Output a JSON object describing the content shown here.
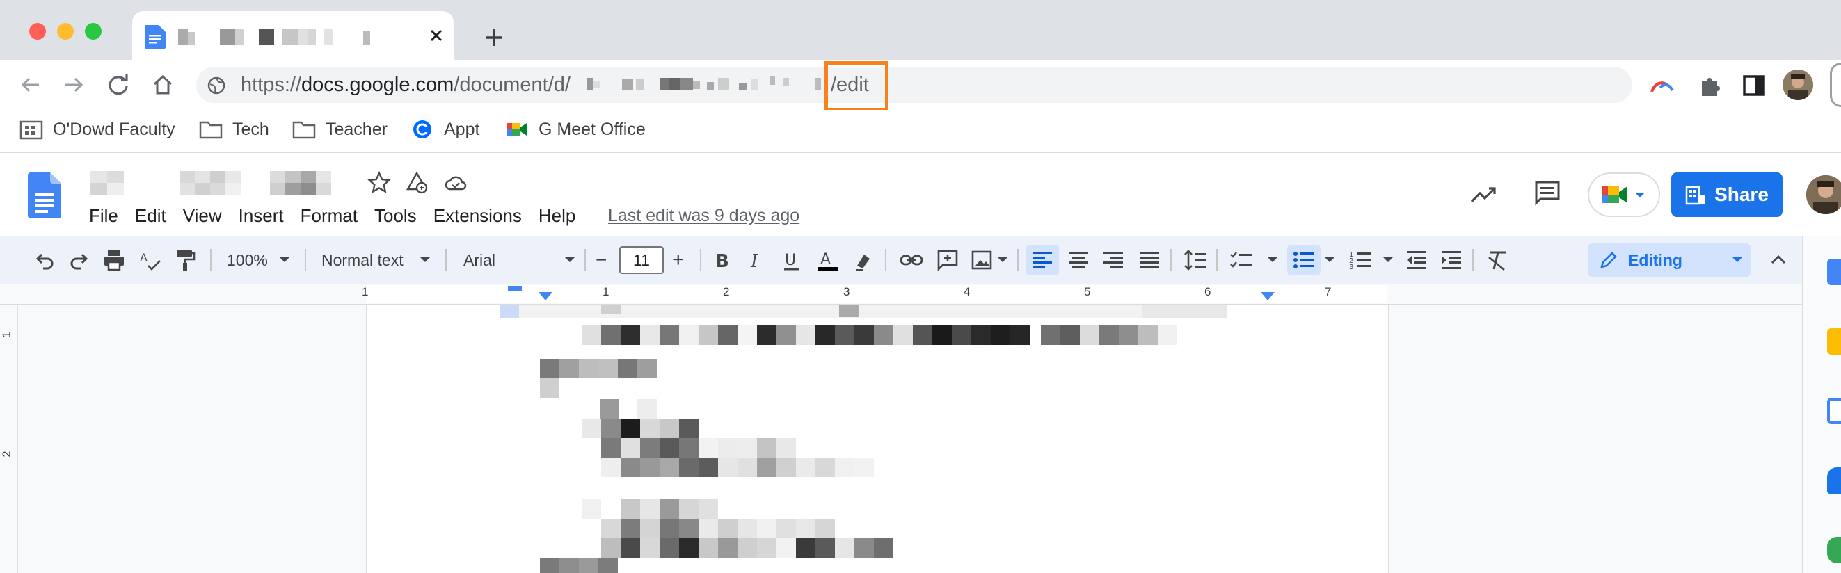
{
  "browser": {
    "tab": {
      "title": ""
    },
    "new_tab_symbol": "+",
    "url": {
      "prefix": "https://",
      "host": "docs.google.com",
      "path": "/document/d/",
      "suffix": "/edit"
    },
    "bookmarks": [
      {
        "label": "O'Dowd Faculty",
        "icon": "bookmark-icon"
      },
      {
        "label": "Tech",
        "icon": "folder-icon"
      },
      {
        "label": "Teacher",
        "icon": "folder-icon"
      },
      {
        "label": "Appt",
        "icon": "calendly-icon"
      },
      {
        "label": "G Meet Office",
        "icon": "google-meet-icon"
      }
    ]
  },
  "docs": {
    "menu": [
      "File",
      "Edit",
      "View",
      "Insert",
      "Format",
      "Tools",
      "Extensions",
      "Help"
    ],
    "last_edit": "Last edit was 9 days ago",
    "share_label": "Share",
    "toolbar": {
      "zoom": "100%",
      "style": "Normal text",
      "font": "Arial",
      "font_size": "11",
      "minus": "−",
      "plus": "+",
      "mode": "Editing"
    },
    "ruler": {
      "h": [
        "1",
        "1",
        "2",
        "3",
        "4",
        "5",
        "6",
        "7"
      ],
      "v": [
        "1",
        "2"
      ]
    }
  },
  "colors": {
    "tabstrip": "#dee1e6",
    "accent": "#1a73e8",
    "highlight_box": "#f5821f",
    "active_tool": "#d3e3fd"
  }
}
